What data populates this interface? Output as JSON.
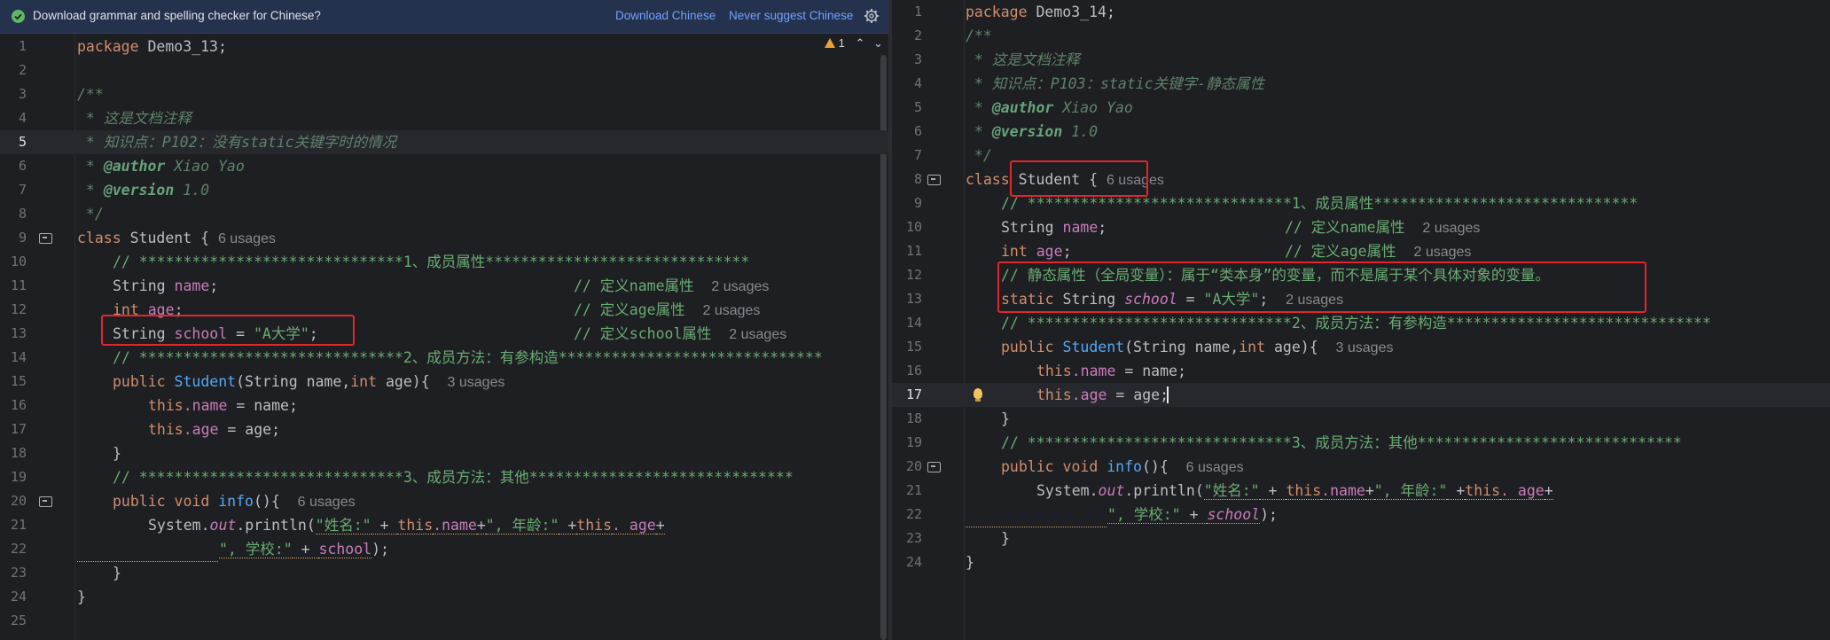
{
  "notification": {
    "message": "Download grammar and spelling checker for Chinese?",
    "download_label": "Download Chinese",
    "never_label": "Never suggest Chinese",
    "settings_icon": "gear-icon"
  },
  "left_editor": {
    "warning_count": "1",
    "lines": [
      "1",
      "2",
      "3",
      "4",
      "5",
      "6",
      "7",
      "8",
      "9",
      "10",
      "11",
      "12",
      "13",
      "14",
      "15",
      "16",
      "17",
      "18",
      "19",
      "20",
      "21",
      "22",
      "23",
      "24",
      "25"
    ],
    "current_line": "5",
    "code": {
      "package_kw": "package",
      "package_name": " Demo3_13;",
      "doc_open": "/**",
      "doc_line1": " * 这是文档注释",
      "doc_line2": " * 知识点：P102：没有static关键字时的情况",
      "author_tag": "@author",
      "author_name": " Xiao Yao",
      "version_tag": "@version",
      "version_num": " 1.0",
      "doc_close": " */",
      "class_kw": "class",
      "class_name": " Student { ",
      "class_usages": "6 usages",
      "section1_comment": "// ******************************1、成员属性******************************",
      "name_decl": "String ",
      "name_field": "name",
      "name_end": ";",
      "name_comment": "// 定义name属性",
      "name_usages": "2 usages",
      "age_type": "int",
      "age_field": " age",
      "age_end": ";",
      "age_comment": "// 定义age属性",
      "age_usages": "2 usages",
      "school_type": "String ",
      "school_field": "school",
      "school_eq": " = ",
      "school_value": "\"A大学\"",
      "school_end": ";",
      "school_comment": "// 定义school属性",
      "school_usages": "2 usages",
      "section2_comment": "// ******************************2、成员方法：有参构造******************************",
      "ctor_public": "public ",
      "ctor_name": "Student",
      "ctor_params_a": "(String name,",
      "ctor_int": "int",
      "ctor_params_b": " age){",
      "ctor_usages": "3 usages",
      "this1": "this",
      "this1_field": ".name",
      "this1_rest": " = name;",
      "this2": "this",
      "this2_field": ".age",
      "this2_rest": " = age;",
      "close_brace": "}",
      "section3_comment": "// ******************************3、成员方法：其他******************************",
      "info_public": "public ",
      "info_void": "void ",
      "info_name": "info",
      "info_parens": "(){",
      "info_usages": "6 usages",
      "println_prefix": "System.",
      "println_out": "out",
      "println_call": ".println(",
      "println_str1": "\"姓名:\"",
      "println_plus1": " + ",
      "println_this1": "this",
      "println_name": ".name",
      "println_plus2": "+",
      "println_str2": "\", 年龄:\"",
      "println_plus3": " +",
      "println_this2": "this",
      "println_age": ". age",
      "println_plus4": "+",
      "cont_str": "\", 学校:\"",
      "cont_plus": " + ",
      "cont_school": "school",
      "cont_end": ");"
    }
  },
  "right_editor": {
    "lines": [
      "1",
      "2",
      "3",
      "4",
      "5",
      "6",
      "7",
      "8",
      "9",
      "10",
      "11",
      "12",
      "13",
      "14",
      "15",
      "16",
      "17",
      "18",
      "19",
      "20",
      "21",
      "22",
      "23",
      "24"
    ],
    "current_line": "17",
    "code": {
      "package_kw": "package",
      "package_name": " Demo3_14;",
      "doc_open": "/**",
      "doc_line1": " * 这是文档注释",
      "doc_line2": " * 知识点：P103：static关键字-静态属性",
      "author_tag": "@author",
      "author_name": " Xiao Yao",
      "version_tag": "@version",
      "version_num": " 1.0",
      "doc_close": " */",
      "class_kw": "class",
      "class_name": " Student { ",
      "class_usages": "6 usages",
      "section1_comment": "// ******************************1、成员属性******************************",
      "name_decl": "String ",
      "name_field": "name",
      "name_end": ";",
      "name_comment": "// 定义name属性",
      "name_usages": "2 usages",
      "age_type": "int",
      "age_field": " age",
      "age_end": ";",
      "age_comment": "// 定义age属性",
      "age_usages": "2 usages",
      "static_comment": "// 静态属性（全局变量）：属于“类本身”的变量，而不是属于某个具体对象的变量。",
      "static_kw": "static ",
      "static_type": "String ",
      "school_field": "school",
      "school_eq": " = ",
      "school_value": "\"A大学\"",
      "school_end": ";",
      "school_usages": "2 usages",
      "section2_comment": "// ******************************2、成员方法：有参构造******************************",
      "ctor_public": "public ",
      "ctor_name": "Student",
      "ctor_params_a": "(String name,",
      "ctor_int": "int",
      "ctor_params_b": " age){",
      "ctor_usages": "3 usages",
      "this1": "this",
      "this1_field": ".name",
      "this1_rest": " = name;",
      "this2": "this",
      "this2_field": ".age",
      "this2_rest": " = age;",
      "close_brace": "}",
      "section3_comment": "// ******************************3、成员方法：其他******************************",
      "info_public": "public ",
      "info_void": "void ",
      "info_name": "info",
      "info_parens": "(){",
      "info_usages": "6 usages",
      "println_prefix": "System.",
      "println_out": "out",
      "println_call": ".println(",
      "println_str1": "\"姓名:\"",
      "println_plus1": " + ",
      "println_this1": "this",
      "println_name": ".name",
      "println_plus2": "+",
      "println_str2": "\", 年龄:\"",
      "println_plus3": " +",
      "println_this2": "this",
      "println_age": ". age",
      "println_plus4": "+",
      "cont_str": "\", 学校:\"",
      "cont_plus": " + ",
      "cont_school": "school",
      "cont_end": ");"
    }
  }
}
